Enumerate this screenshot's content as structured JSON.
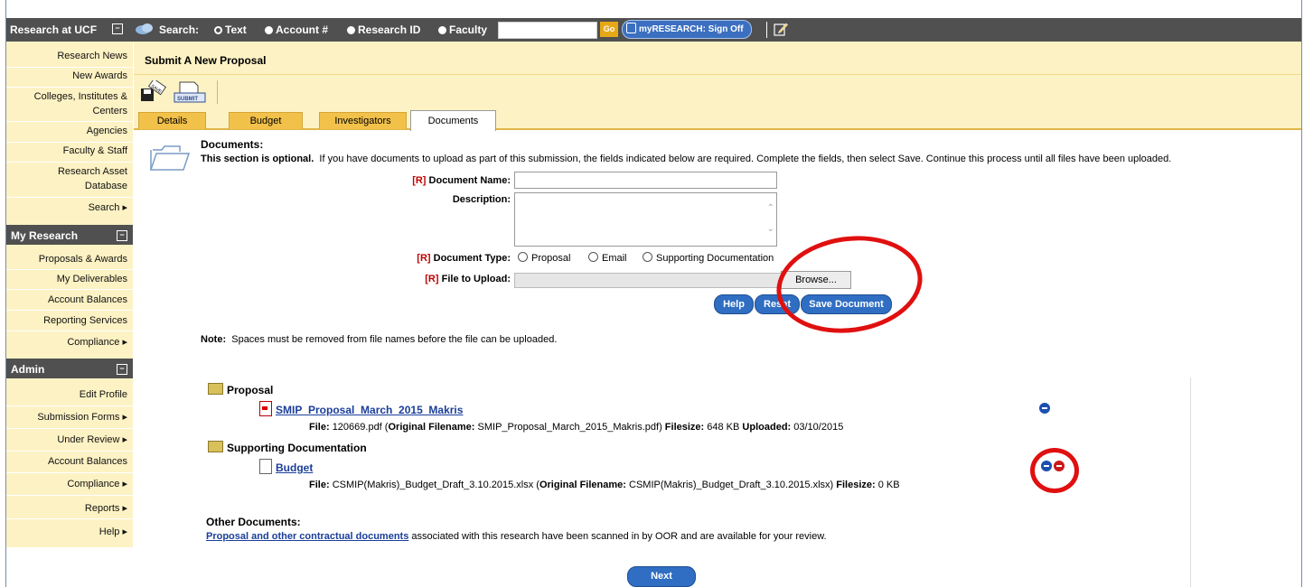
{
  "topbar": {
    "brand": "Research at UCF",
    "search_label": "Search:",
    "search_options": [
      "Text",
      "Account #",
      "Research ID",
      "Faculty"
    ],
    "search_selected": "Text",
    "go_label": "Go",
    "signoff_label": "myRESEARCH: Sign Off"
  },
  "sidebar": {
    "research_items": [
      "Research News",
      "New Awards",
      "Colleges, Institutes &",
      "Centers",
      "Agencies",
      "Faculty & Staff",
      "Research Asset",
      "Database",
      "Search"
    ],
    "my_research_title": "My Research",
    "my_research_items": [
      "Proposals & Awards",
      "My Deliverables",
      "Account Balances",
      "Reporting Services",
      "Compliance"
    ],
    "admin_title": "Admin",
    "admin_items": [
      "Edit Profile",
      "Submission Forms",
      "Under Review",
      "Account Balances",
      "Compliance",
      "Reports",
      "Help"
    ]
  },
  "page": {
    "title": "Submit A New Proposal",
    "tool_save": "SAVE",
    "tool_submit": "SUBMIT",
    "tabs": [
      "Details",
      "Budget",
      "Investigators",
      "Documents"
    ],
    "active_tab": "Documents"
  },
  "documents": {
    "heading": "Documents:",
    "optional_bold": "This section is optional.",
    "optional_text": "If you have documents to upload as part of this submission, the fields indicated below are required. Complete the fields, then select Save. Continue this process until all files have been uploaded.",
    "req_marker": "[R]",
    "doc_name_label": "Document Name:",
    "description_label": "Description:",
    "doc_type_label": "Document Type:",
    "doc_types": [
      "Proposal",
      "Email",
      "Supporting Documentation"
    ],
    "file_label": "File to Upload:",
    "browse_label": "Browse...",
    "help_label": "Help",
    "reset_label": "Reset",
    "save_label": "Save Document",
    "note_label": "Note:",
    "note_text": "Spaces must be removed from file names before the file can be uploaded."
  },
  "files": {
    "proposal_group": "Proposal",
    "proposal_link": "SMIP_Proposal_March_2015_Makris",
    "proposal_file_label": "File:",
    "proposal_file": "120669.pdf",
    "original_label": "Original Filename:",
    "proposal_original": "SMIP_Proposal_March_2015_Makris.pdf",
    "filesize_label": "Filesize:",
    "proposal_size": "648 KB",
    "uploaded_label": "Uploaded:",
    "proposal_uploaded": "03/10/2015",
    "support_group": "Supporting Documentation",
    "budget_link": "Budget",
    "budget_file": "CSMIP(Makris)_Budget_Draft_3.10.2015.xlsx",
    "budget_original": "CSMIP(Makris)_Budget_Draft_3.10.2015.xlsx",
    "budget_size": "0 KB"
  },
  "other": {
    "heading": "Other Documents:",
    "link": "Proposal and other contractual documents",
    "text": "associated with this research have been scanned in by OOR and are available for your review."
  },
  "next_label": "Next",
  "colors": {
    "header_bg": "#505050",
    "sidebar_bg": "#fdf2c4",
    "tab_bg": "#f2c14a",
    "button_blue": "#2f6ec2",
    "annotation_red": "#e01010"
  }
}
